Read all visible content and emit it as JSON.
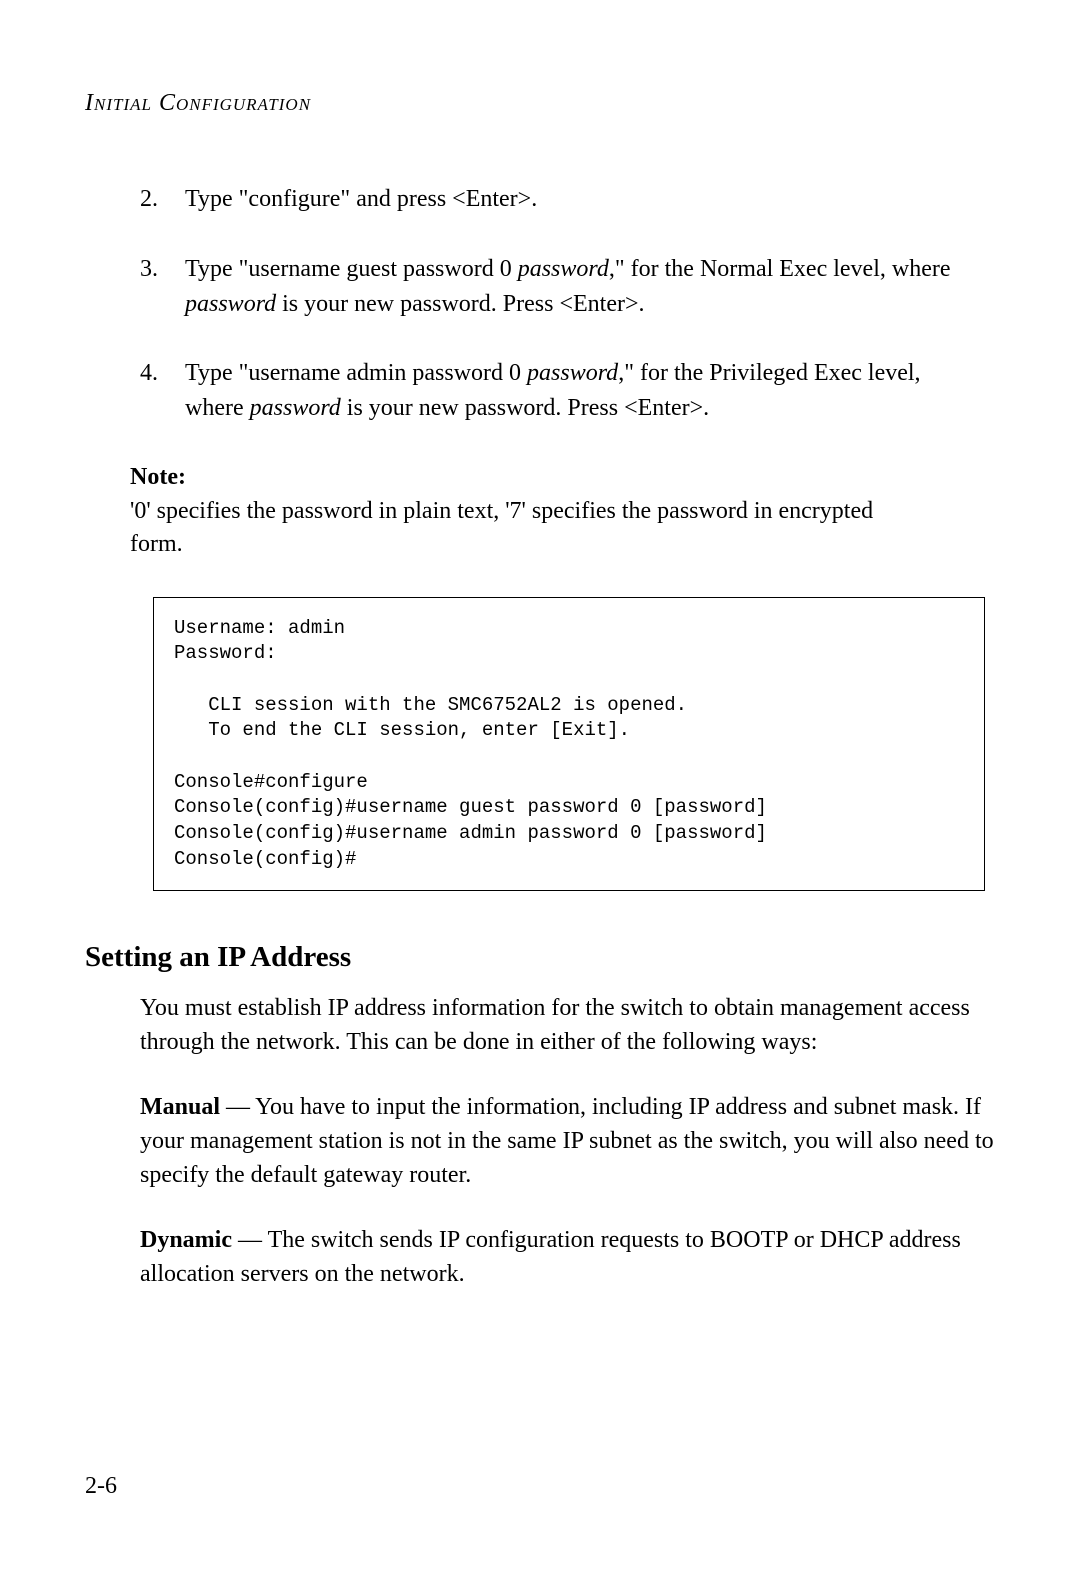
{
  "header": "Initial Configuration",
  "steps": [
    {
      "num": "2.",
      "parts": [
        {
          "t": "Type \"configure\" and press <Enter>."
        }
      ]
    },
    {
      "num": "3.",
      "parts": [
        {
          "t": "Type \"username guest password 0 "
        },
        {
          "t": "password",
          "i": true
        },
        {
          "t": ",\" for the Normal Exec level, where "
        },
        {
          "t": "password",
          "i": true
        },
        {
          "t": " is your new password. Press <Enter>."
        }
      ]
    },
    {
      "num": "4.",
      "parts": [
        {
          "t": "Type \"username admin password 0 "
        },
        {
          "t": "password",
          "i": true
        },
        {
          "t": ",\" for the Privileged Exec level, where "
        },
        {
          "t": "password",
          "i": true
        },
        {
          "t": " is your new password. Press <Enter>."
        }
      ]
    }
  ],
  "note": {
    "label": "Note:",
    "text": "'0' specifies the password in plain text, '7' specifies the password in encrypted form."
  },
  "code": "Username: admin\nPassword:\n\n   CLI session with the SMC6752AL2 is opened.\n   To end the CLI session, enter [Exit].\n\nConsole#configure\nConsole(config)#username guest password 0 [password]\nConsole(config)#username admin password 0 [password]\nConsole(config)#",
  "section_heading": "Setting an IP Address",
  "paras": [
    [
      {
        "t": "You must establish IP address information for the switch to obtain management access through the network. This can be done in either of the following ways:"
      }
    ],
    [
      {
        "t": "Manual",
        "b": true
      },
      {
        "t": " — You have to input the information, including IP address and subnet mask. If your management station is not in the same IP subnet as the switch, you will also need to specify the default gateway router."
      }
    ],
    [
      {
        "t": "Dynamic",
        "b": true
      },
      {
        "t": " — The switch sends IP configuration requests to BOOTP or DHCP address allocation servers on the network."
      }
    ]
  ],
  "page_num": "2-6"
}
